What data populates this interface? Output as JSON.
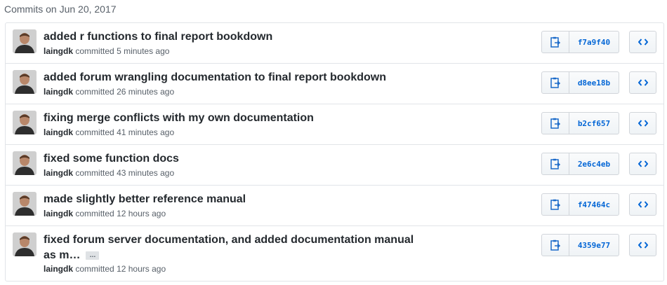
{
  "group_header": "Commits on Jun 20, 2017",
  "committed_word": "committed",
  "commits": [
    {
      "title": "added r functions to final report bookdown",
      "author": "laingdk",
      "time": "5 minutes ago",
      "sha": "f7a9f40"
    },
    {
      "title": "added forum wrangling documentation to final report bookdown",
      "author": "laingdk",
      "time": "26 minutes ago",
      "sha": "d8ee18b"
    },
    {
      "title": "fixing merge conflicts with my own documentation",
      "author": "laingdk",
      "time": "41 minutes ago",
      "sha": "b2cf657"
    },
    {
      "title": "fixed some function docs",
      "author": "laingdk",
      "time": "43 minutes ago",
      "sha": "2e6c4eb"
    },
    {
      "title": "made slightly better reference manual",
      "author": "laingdk",
      "time": "12 hours ago",
      "sha": "f47464c"
    },
    {
      "title": "fixed forum server documentation, and added documentation manual as m…",
      "author": "laingdk",
      "time": "12 hours ago",
      "sha": "4359e77",
      "ellipsis": "…"
    }
  ],
  "colors": {
    "link": "#0366d6",
    "border": "#e1e4e8",
    "text": "#24292e",
    "muted": "#586069"
  },
  "icons": {
    "copy": "clippy-icon",
    "browse": "code-icon"
  }
}
